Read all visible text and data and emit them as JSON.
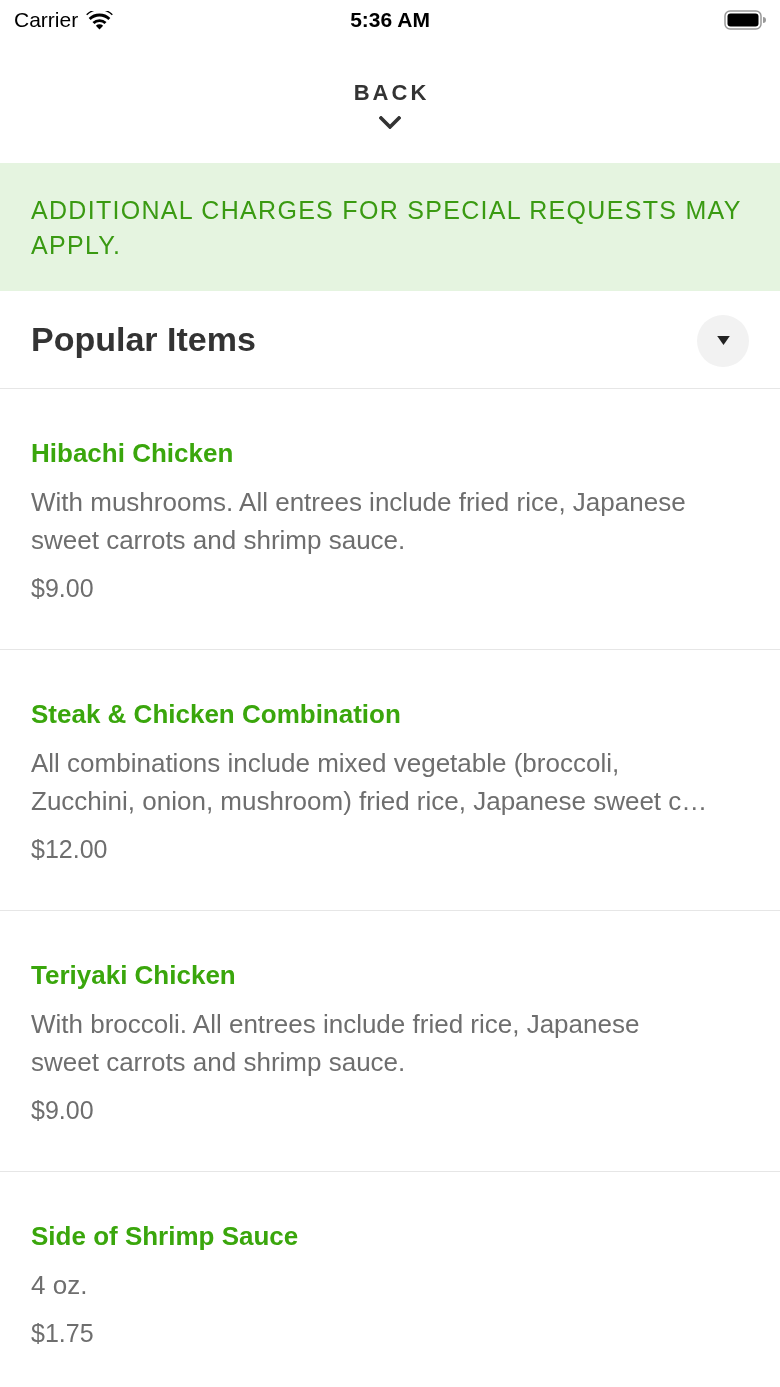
{
  "status_bar": {
    "carrier": "Carrier",
    "time": "5:36 AM"
  },
  "header": {
    "back_label": "BACK"
  },
  "notice": {
    "text": "ADDITIONAL CHARGES FOR SPECIAL REQUESTS MAY APPLY."
  },
  "section": {
    "title": "Popular Items"
  },
  "items": [
    {
      "name": "Hibachi Chicken",
      "description": "With mushrooms. All entrees include fried rice, Japanese sweet carrots and shrimp sauce.",
      "price": "$9.00"
    },
    {
      "name": "Steak & Chicken Combination",
      "description": "All combinations include mixed vegetable (broccoli, Zucchini, onion, mushroom) fried rice, Japanese sweet c…",
      "price": "$12.00"
    },
    {
      "name": "Teriyaki Chicken",
      "description": "With broccoli. All entrees include fried rice, Japanese sweet carrots and shrimp sauce.",
      "price": "$9.00"
    },
    {
      "name": "Side of Shrimp Sauce",
      "description": "4 oz.",
      "price": "$1.75"
    }
  ]
}
